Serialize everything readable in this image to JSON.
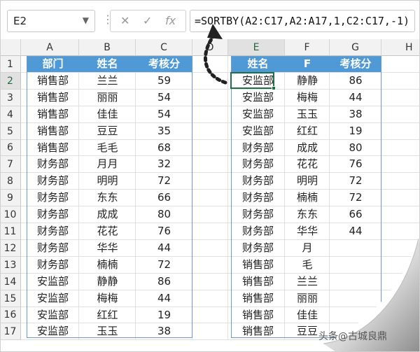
{
  "formula_bar": {
    "name_box": "E2",
    "name_box_arrow": "▼",
    "menu_dots": "⋮",
    "cancel_symbol": "✕",
    "enter_symbol": "✓",
    "function_symbol": "fx",
    "formula": "=SORTBY(A2:C17,A2:A17,1,C2:C17,-1)"
  },
  "grid": {
    "columns": [
      "A",
      "B",
      "C",
      "D",
      "E",
      "F",
      "G",
      "H"
    ],
    "rows": [
      "1",
      "2",
      "3",
      "4",
      "5",
      "6",
      "7",
      "8",
      "9",
      "10",
      "11",
      "12",
      "13",
      "14",
      "15",
      "16",
      "17"
    ],
    "active_cell": "E2"
  },
  "source_table": {
    "headers": [
      "部门",
      "姓名",
      "考核分"
    ],
    "rows": [
      [
        "销售部",
        "兰兰",
        "59"
      ],
      [
        "销售部",
        "丽丽",
        "54"
      ],
      [
        "销售部",
        "佳佳",
        "54"
      ],
      [
        "销售部",
        "豆豆",
        "35"
      ],
      [
        "销售部",
        "毛毛",
        "68"
      ],
      [
        "财务部",
        "月月",
        "32"
      ],
      [
        "财务部",
        "明明",
        "72"
      ],
      [
        "财务部",
        "东东",
        "66"
      ],
      [
        "财务部",
        "成成",
        "80"
      ],
      [
        "财务部",
        "花花",
        "76"
      ],
      [
        "财务部",
        "华华",
        "44"
      ],
      [
        "财务部",
        "楠楠",
        "72"
      ],
      [
        "安监部",
        "静静",
        "86"
      ],
      [
        "安监部",
        "梅梅",
        "44"
      ],
      [
        "安监部",
        "红红",
        "19"
      ],
      [
        "安监部",
        "玉玉",
        "38"
      ]
    ]
  },
  "result_table": {
    "headers": [
      "姓名",
      "F",
      "考核分"
    ],
    "rows": [
      [
        "安监部",
        "静静",
        "86"
      ],
      [
        "安监部",
        "梅梅",
        "44"
      ],
      [
        "安监部",
        "玉玉",
        "38"
      ],
      [
        "安监部",
        "红红",
        "19"
      ],
      [
        "财务部",
        "成成",
        "80"
      ],
      [
        "财务部",
        "花花",
        "76"
      ],
      [
        "财务部",
        "明明",
        "72"
      ],
      [
        "财务部",
        "楠楠",
        "72"
      ],
      [
        "财务部",
        "东东",
        "66"
      ],
      [
        "财务部",
        "华华",
        "44"
      ],
      [
        "财务部",
        "月",
        ""
      ],
      [
        "销售部",
        "毛",
        ""
      ],
      [
        "销售部",
        "兰兰",
        ""
      ],
      [
        "销售部",
        "丽丽",
        ""
      ],
      [
        "销售部",
        "佳佳",
        ""
      ],
      [
        "销售部",
        "豆豆",
        ""
      ]
    ]
  },
  "watermark": "头条@古城良鼎",
  "colors": {
    "header_fill": "#4f9ad6",
    "table_border": "#6b9bc7",
    "selection": "#1e7145"
  }
}
